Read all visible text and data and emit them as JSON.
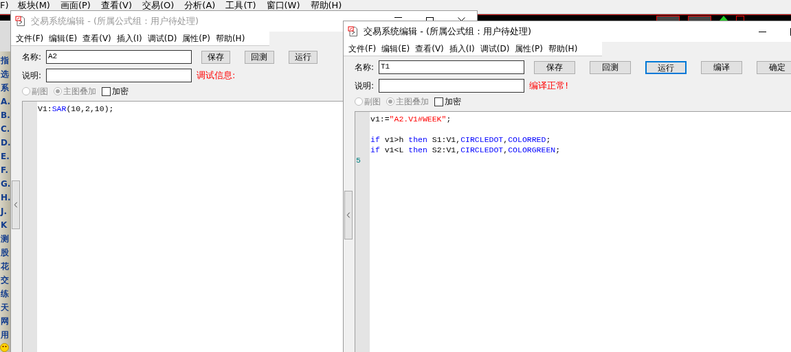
{
  "main_menu": [
    "F)",
    "板块(M)",
    "画面(P)",
    "查看(V)",
    "交易(O)",
    "分析(A)",
    "工具(T)",
    "窗口(W)",
    "帮助(H)"
  ],
  "sidebar": {
    "items": [
      "指",
      "选",
      "系",
      "A.",
      "B.",
      "C.",
      "D.",
      "E.",
      "F.",
      "G.",
      "H.",
      "J.",
      "K",
      "测",
      "股",
      "花",
      "交",
      "练",
      "天",
      "网",
      "用"
    ]
  },
  "windows": [
    {
      "title": "交易系统编辑 - (所属公式组：用户待处理)",
      "active": false,
      "title_buttons": [
        {
          "kind": "minimize"
        },
        {
          "kind": "maximize"
        },
        {
          "kind": "close"
        }
      ],
      "menu": [
        "文件(F)",
        "编辑(E)",
        "查看(V)",
        "插入(I)",
        "调试(D)",
        "属性(P)",
        "帮助(H)"
      ],
      "name_label": "名称:",
      "name_value": "A2",
      "desc_label": "说明:",
      "message": "调试信息:",
      "buttons": [
        {
          "label": "保存",
          "focused": false
        },
        {
          "label": "回测",
          "focused": false
        },
        {
          "label": "运行",
          "focused": false
        }
      ],
      "options": [
        {
          "kind": "radio",
          "label": "副图",
          "checked": false,
          "disabled": true
        },
        {
          "kind": "radio",
          "label": "主图叠加",
          "checked": true,
          "disabled": true
        },
        {
          "kind": "checkbox",
          "label": "加密",
          "checked": false,
          "disabled": false
        }
      ],
      "code": [
        {
          "kind": "code",
          "tokens": [
            {
              "kind": "plain",
              "text": "V1:"
            },
            {
              "kind": "function",
              "text": "SAR"
            },
            {
              "kind": "plain",
              "text": "(10,2,10);"
            }
          ]
        }
      ]
    },
    {
      "title": "交易系统编辑 - (所属公式组：用户待处理)",
      "active": true,
      "title_buttons": [
        {
          "kind": "minimize"
        },
        {
          "kind": "maximize"
        }
      ],
      "menu": [
        "文件(F)",
        "编辑(E)",
        "查看(V)",
        "插入(I)",
        "调试(D)",
        "属性(P)",
        "帮助(H)"
      ],
      "name_label": "名称:",
      "name_value": "T1",
      "desc_label": "说明:",
      "message": "编译正常!",
      "buttons": [
        {
          "label": "保存",
          "focused": false
        },
        {
          "label": "回测",
          "focused": false
        },
        {
          "label": "运行",
          "focused": true
        },
        {
          "label": "编译",
          "focused": false
        },
        {
          "label": "确定",
          "focused": false
        }
      ],
      "options": [
        {
          "kind": "radio",
          "label": "副图",
          "checked": false,
          "disabled": true
        },
        {
          "kind": "radio",
          "label": "主图叠加",
          "checked": true,
          "disabled": true
        },
        {
          "kind": "checkbox",
          "label": "加密",
          "checked": false,
          "disabled": false
        }
      ],
      "code": [
        {
          "kind": "code",
          "tokens": [
            {
              "kind": "plain",
              "text": "v1:="
            },
            {
              "kind": "string",
              "text": "\"A2.V1#WEEK\""
            },
            {
              "kind": "plain",
              "text": ";"
            }
          ]
        },
        {
          "kind": "blank"
        },
        {
          "kind": "code",
          "tokens": [
            {
              "kind": "keyword",
              "text": "if"
            },
            {
              "kind": "plain",
              "text": " v1>h "
            },
            {
              "kind": "keyword",
              "text": "then"
            },
            {
              "kind": "plain",
              "text": " S1:V1,"
            },
            {
              "kind": "function",
              "text": "CIRCLEDOT"
            },
            {
              "kind": "plain",
              "text": ","
            },
            {
              "kind": "function",
              "text": "COLORRED"
            },
            {
              "kind": "plain",
              "text": ";"
            }
          ]
        },
        {
          "kind": "code",
          "tokens": [
            {
              "kind": "keyword",
              "text": "if"
            },
            {
              "kind": "plain",
              "text": " v1<L "
            },
            {
              "kind": "keyword",
              "text": "then"
            },
            {
              "kind": "plain",
              "text": " S2:V1,"
            },
            {
              "kind": "function",
              "text": "CIRCLEDOT"
            },
            {
              "kind": "plain",
              "text": ","
            },
            {
              "kind": "function",
              "text": "COLORGREEN"
            },
            {
              "kind": "plain",
              "text": ";"
            }
          ]
        },
        {
          "kind": "current",
          "number": "5"
        }
      ]
    }
  ]
}
